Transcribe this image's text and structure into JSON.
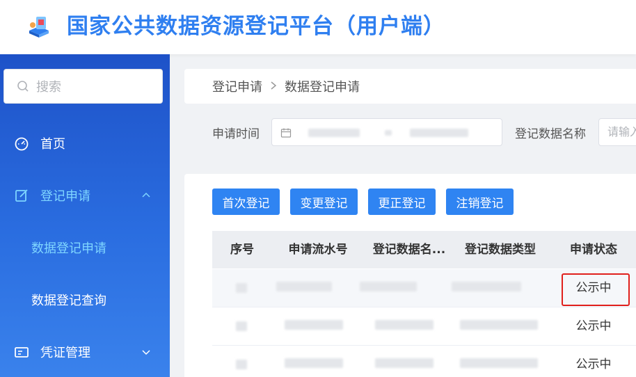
{
  "header": {
    "title": "国家公共数据资源登记平台（用户端）"
  },
  "sidebar": {
    "search_placeholder": "搜索",
    "items": [
      {
        "label": "首页",
        "icon": "dashboard-icon"
      },
      {
        "label": "登记申请",
        "icon": "edit-icon",
        "expanded": true
      },
      {
        "label": "凭证管理",
        "icon": "certificate-icon",
        "expanded": false
      }
    ],
    "sub_items": [
      {
        "label": "数据登记申请",
        "active": true
      },
      {
        "label": "数据登记查询",
        "active": false
      }
    ]
  },
  "breadcrumb": {
    "parent": "登记申请",
    "current": "数据登记申请"
  },
  "filters": {
    "apply_time_label": "申请时间",
    "data_name_label": "登记数据名称",
    "data_name_placeholder": "请输入"
  },
  "actions": {
    "first_register": "首次登记",
    "change_register": "变更登记",
    "correct_register": "更正登记",
    "cancel_register": "注销登记"
  },
  "table": {
    "columns": [
      "序号",
      "申请流水号",
      "登记数据名...",
      "登记数据类型",
      "申请状态"
    ],
    "rows": [
      {
        "status": "公示中"
      },
      {
        "status": "公示中"
      },
      {
        "status": "公示中"
      }
    ]
  },
  "colors": {
    "primary": "#2f84f2",
    "sidebar_top": "#1e52c8",
    "highlight": "#e0201c"
  }
}
